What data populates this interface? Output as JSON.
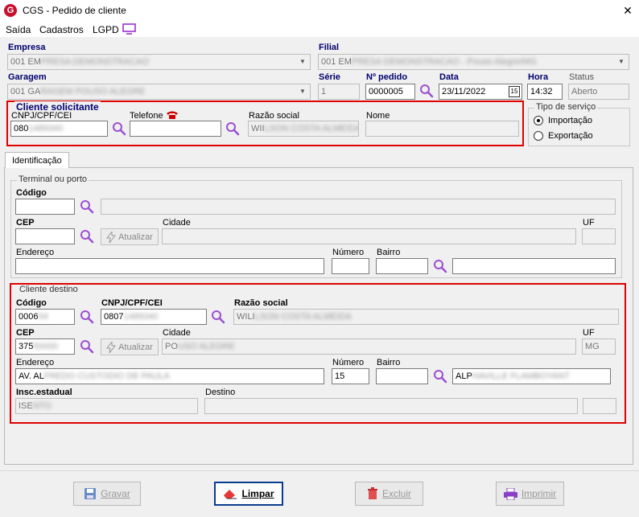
{
  "window": {
    "title": "CGS - Pedido de cliente",
    "close": "✕",
    "app_icon": "G"
  },
  "menu": {
    "saida": "Saída",
    "cadastros": "Cadastros",
    "lgpd": "LGPD"
  },
  "header": {
    "empresa_label": "Empresa",
    "empresa_value": "001 EM",
    "filial_label": "Filial",
    "filial_value": "001 EM",
    "garagem_label": "Garagem",
    "garagem_value": "001 GA",
    "serie_label": "Série",
    "serie_value": "1",
    "pedido_label": "Nº pedido",
    "pedido_value": "0000005",
    "data_label": "Data",
    "data_value": "23/11/2022",
    "data_cal": "15",
    "hora_label": "Hora",
    "hora_value": "14:32",
    "status_label": "Status",
    "status_value": "Aberto"
  },
  "solicitante": {
    "title": "Cliente solicitante",
    "cnpj_label": "CNPJ/CPF/CEI",
    "cnpj_value": "080",
    "telefone_label": "Telefone",
    "razao_label": "Razão social",
    "razao_value": "WII",
    "nome_label": "Nome",
    "nome_value": ""
  },
  "tipo_servico": {
    "title": "Tipo de serviço",
    "importacao": "Importação",
    "exportacao": "Exportação",
    "selected": "Importação"
  },
  "tabs": {
    "identificacao": "Identificação"
  },
  "terminal": {
    "title": "Terminal ou porto",
    "codigo_label": "Código",
    "cep_label": "CEP",
    "cidade_label": "Cidade",
    "uf_label": "UF",
    "atualizar": "Atualizar",
    "endereco_label": "Endereço",
    "numero_label": "Número",
    "bairro_label": "Bairro"
  },
  "destino": {
    "title": "Cliente destino",
    "codigo_label": "Código",
    "codigo_value": "0006",
    "cnpj_label": "CNPJ/CPF/CEI",
    "cnpj_value": "0807",
    "razao_label": "Razão social",
    "razao_value": "WILI",
    "cep_label": "CEP",
    "cep_value": "375",
    "atualizar": "Atualizar",
    "cidade_label": "Cidade",
    "cidade_value": "PO",
    "uf_label": "UF",
    "uf_value": "MG",
    "endereco_label": "Endereço",
    "endereco_value": "AV. AL",
    "numero_label": "Número",
    "numero_value": "15",
    "bairro_label": "Bairro",
    "bairro_value": "ALP",
    "insc_label": "Insc.estadual",
    "insc_value": "ISE",
    "destino_label": "Destino"
  },
  "buttons": {
    "gravar": "Gravar",
    "limpar": "Limpar",
    "excluir": "Excluir",
    "imprimir": "Imprimir"
  },
  "colors": {
    "accent_red": "#e00000",
    "label_blue": "#00006e",
    "search_purple": "#9b4fd1"
  }
}
